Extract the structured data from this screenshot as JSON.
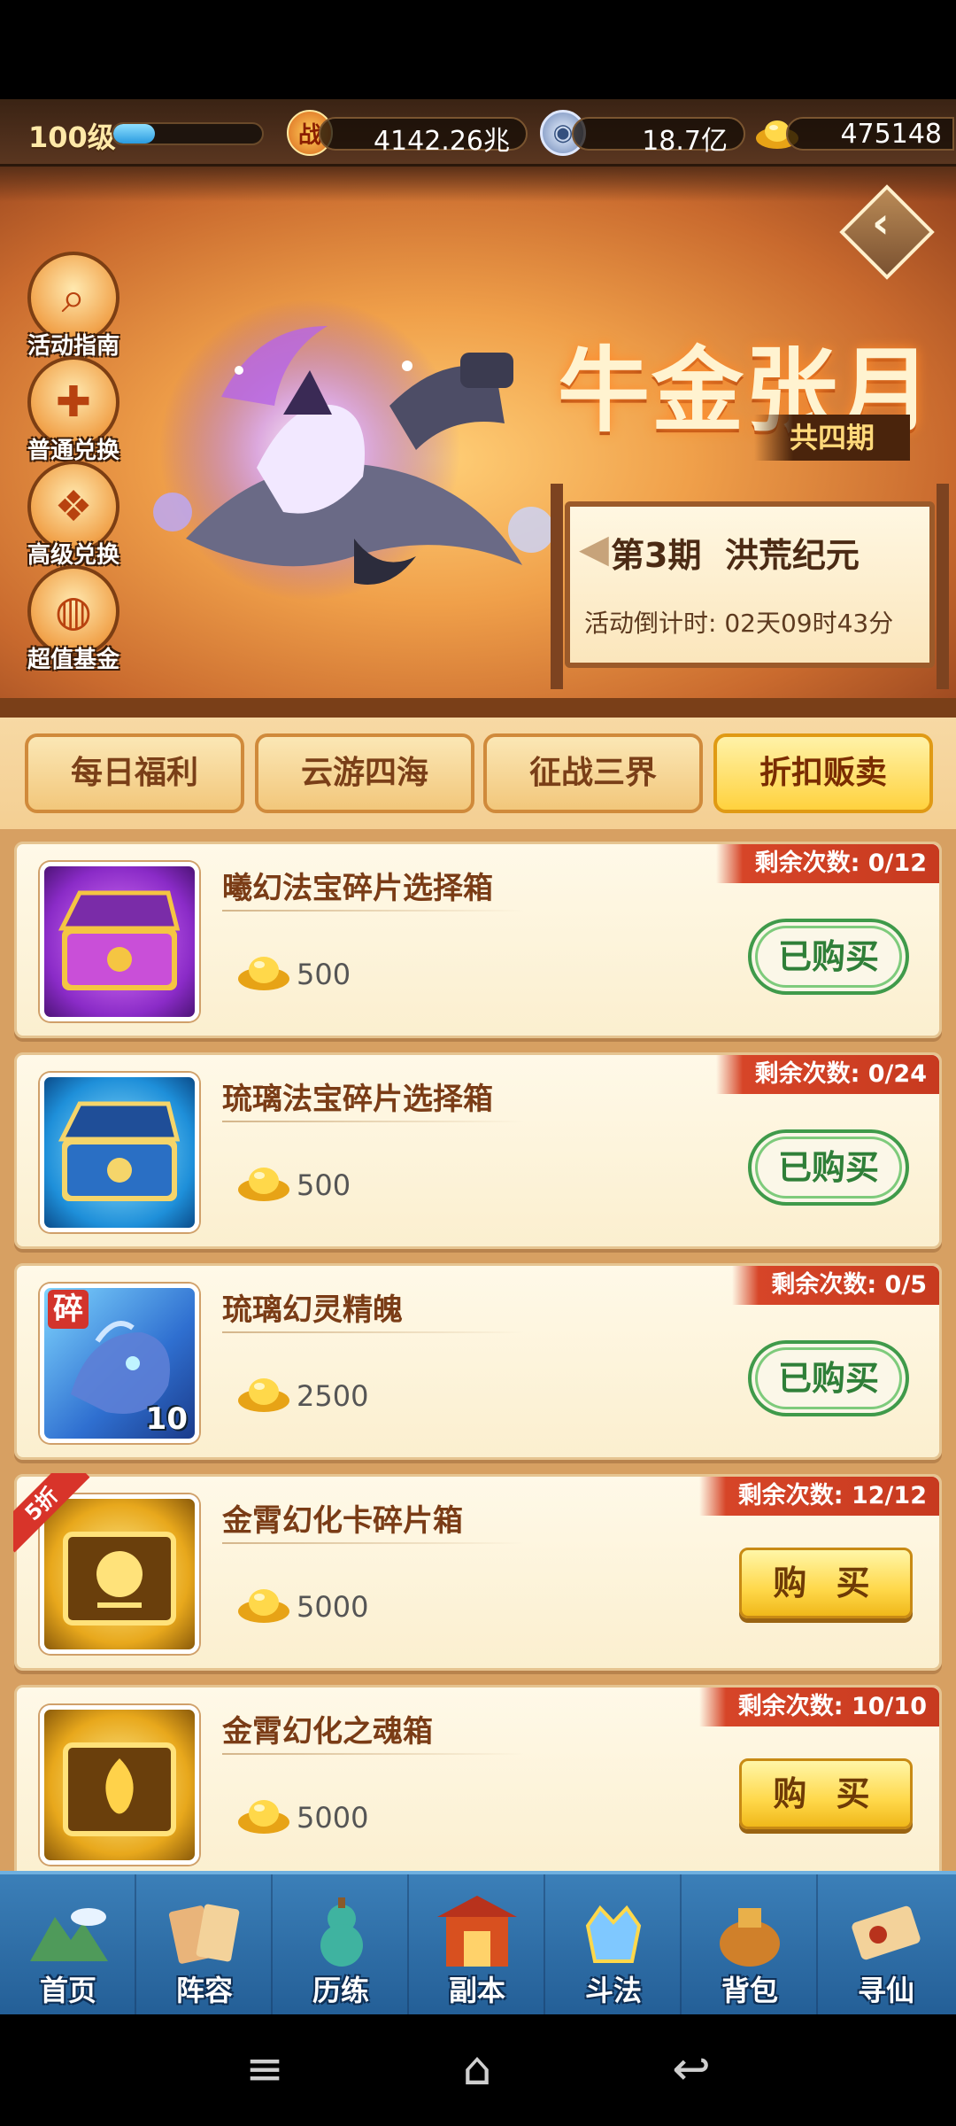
{
  "resources": {
    "level": "100级",
    "exp_progress": 0.28,
    "battle_icon": "战",
    "battle_power": "4142.26兆",
    "silver": "18.7亿",
    "gold": "475148"
  },
  "sidebar": [
    {
      "label": "活动指南",
      "icon": "magnifier-icon"
    },
    {
      "label": "普通兑换",
      "icon": "gift-box-icon"
    },
    {
      "label": "高级兑换",
      "icon": "present-icon"
    },
    {
      "label": "超值基金",
      "icon": "treasure-bag-icon"
    }
  ],
  "banner": {
    "title": "牛金张月",
    "period_total": "共四期",
    "stage": "第3期  洪荒纪元",
    "countdown": "活动倒计时: 02天09时43分"
  },
  "tabs": [
    {
      "label": "每日福利",
      "active": false
    },
    {
      "label": "云游四海",
      "active": false
    },
    {
      "label": "征战三界",
      "active": false
    },
    {
      "label": "折扣贩卖",
      "active": true
    }
  ],
  "items": [
    {
      "name": "曦幻法宝碎片选择箱",
      "price": "500",
      "remaining": "剩余次数: 0/12",
      "button": "已购买",
      "state": "bought",
      "theme": "purple"
    },
    {
      "name": "琉璃法宝碎片选择箱",
      "price": "500",
      "remaining": "剩余次数: 0/24",
      "button": "已购买",
      "state": "bought",
      "theme": "blue"
    },
    {
      "name": "琉璃幻灵精魄",
      "price": "2500",
      "remaining": "剩余次数: 0/5",
      "button": "已购买",
      "state": "bought",
      "theme": "fragment",
      "badge": "碎",
      "qty": "10"
    },
    {
      "name": "金霄幻化卡碎片箱",
      "price": "5000",
      "remaining": "剩余次数: 12/12",
      "button": "购 买",
      "state": "buy",
      "theme": "gold",
      "discount": "5折"
    },
    {
      "name": "金霄幻化之魂箱",
      "price": "5000",
      "remaining": "剩余次数: 10/10",
      "button": "购 买",
      "state": "buy",
      "theme": "gold"
    }
  ],
  "bottom_nav": [
    {
      "label": "首页",
      "icon": "mountain-home-icon"
    },
    {
      "label": "阵容",
      "icon": "cards-icon"
    },
    {
      "label": "历练",
      "icon": "gourd-icon"
    },
    {
      "label": "副本",
      "icon": "temple-gate-icon"
    },
    {
      "label": "斗法",
      "icon": "crown-crest-icon"
    },
    {
      "label": "背包",
      "icon": "treasure-pouch-icon"
    },
    {
      "label": "寻仙",
      "icon": "scroll-icon"
    }
  ],
  "system_nav": {
    "menu": "≡",
    "home": "⌂",
    "back": "↩"
  },
  "colors": {
    "accent": "#ffd23e",
    "bought_green": "#3f9a4a",
    "remaining_red": "#d64528",
    "nav_blue": "#2f70a8"
  }
}
